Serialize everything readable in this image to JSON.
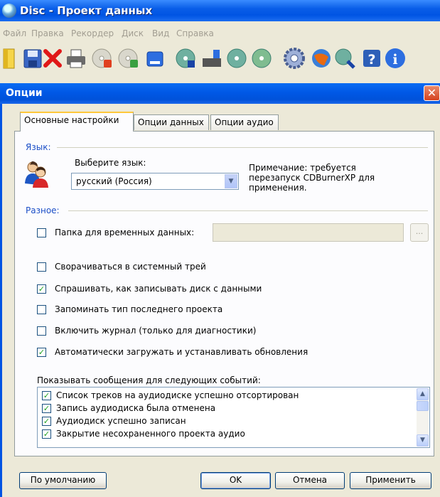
{
  "app": {
    "title": "Disc - Проект данных"
  },
  "menu": [
    "Файл",
    "Правка",
    "Рекордер",
    "Диск",
    "Вид",
    "Справка"
  ],
  "toolbar": {
    "icons": [
      "new-project-icon",
      "save-icon",
      "delete-icon",
      "print-icon",
      "erase-disc-icon",
      "verify-disc-icon",
      "burn-icon",
      "disc-info-icon",
      "burn-image-icon",
      "copy-disc-icon",
      "disc-properties-icon",
      "settings-icon",
      "help-web-icon",
      "find-icon",
      "help-icon",
      "info-icon"
    ]
  },
  "dialog": {
    "title": "Опции",
    "close_glyph": "✕",
    "tabs": [
      "Основные настройки",
      "Опции данных",
      "Опции аудио"
    ],
    "language_group": "Язык:",
    "language_label": "Выберите язык:",
    "language_value": "русский (Россия)",
    "language_note": "Примечание: требуется перезапуск CDBurnerXP для применения.",
    "misc_group": "Разное:",
    "temp_folder_label": "Папка для временных данных:",
    "temp_folder_value": "",
    "browse_label": "...",
    "options": [
      {
        "label": "Сворачиваться в системный трей",
        "checked": false
      },
      {
        "label": "Спрашивать, как записывать диск с данными",
        "checked": true
      },
      {
        "label": "Запоминать тип последнего проекта",
        "checked": false
      },
      {
        "label": "Включить журнал (только для диагностики)",
        "checked": false
      },
      {
        "label": "Автоматически загружать и устанавливать обновления",
        "checked": true
      }
    ],
    "temp_folder_checked": false,
    "events_label": "Показывать сообщения для следующих событий:",
    "events": [
      {
        "label": "Список треков на аудиодиске успешно отсортирован",
        "checked": true
      },
      {
        "label": "Запись аудиодиска была отменена",
        "checked": true
      },
      {
        "label": "Аудиодиск успешно записан",
        "checked": true
      },
      {
        "label": "Закрытие несохраненного проекта аудио",
        "checked": true
      }
    ],
    "buttons": {
      "default": "По умолчанию",
      "ok": "OK",
      "cancel": "Отмена",
      "apply": "Применить"
    }
  }
}
